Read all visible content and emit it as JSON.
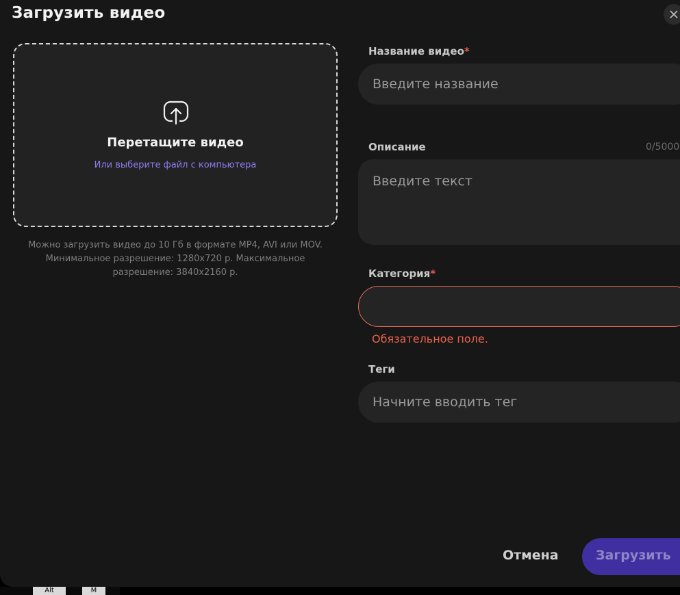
{
  "dialog": {
    "title": "Загрузить видео",
    "close_icon": "close-icon"
  },
  "dropzone": {
    "icon": "upload-icon",
    "title": "Перетащите видео",
    "link": "Или выберите файл с компьютера",
    "hint": "Можно загрузить видео до 10 Гб в формате MP4, AVI или MOV. Минимальное разрешение: 1280x720 р. Максимальное разрешение: 3840x2160 р."
  },
  "form": {
    "title_label": "Название видео",
    "title_placeholder": "Введите название",
    "description_label": "Описание",
    "description_counter": "0/5000",
    "description_placeholder": "Введите текст",
    "category_label": "Категория",
    "category_value": "",
    "category_error": "Обязательное поле.",
    "tags_label": "Теги",
    "tags_placeholder": "Начните вводить тег",
    "required_marker": "*"
  },
  "actions": {
    "cancel": "Отмена",
    "submit": "Загрузить"
  },
  "colors": {
    "background": "#171717",
    "field": "#242424",
    "accent": "#3f2fa0",
    "link": "#8f7cf0",
    "error": "#e8624d"
  },
  "keyboard_strip": [
    "Alt",
    "M"
  ]
}
